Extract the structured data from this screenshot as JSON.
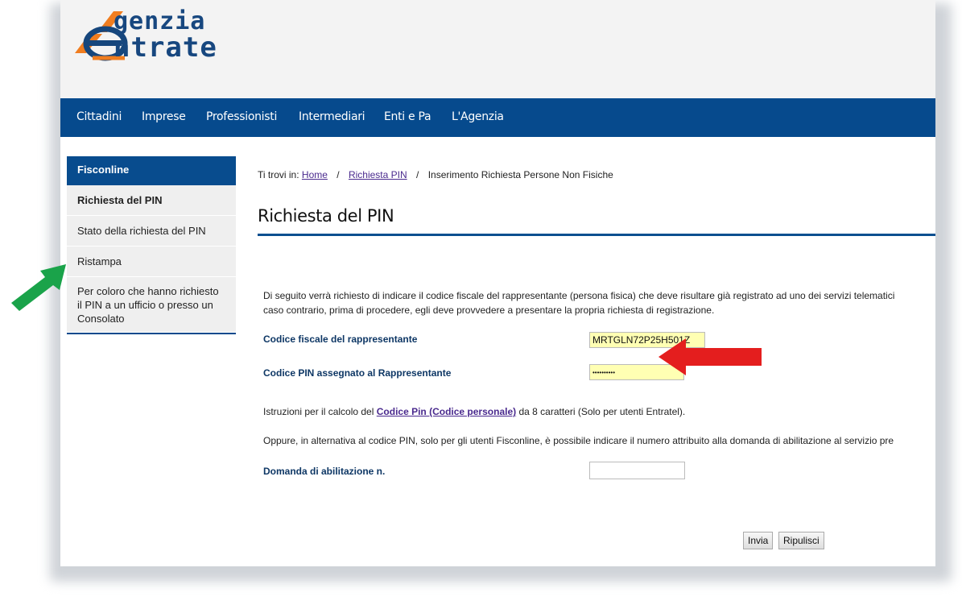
{
  "logo": {
    "line1": "genzia",
    "line2": "ntrate"
  },
  "nav": {
    "items": [
      "Cittadini",
      "Imprese",
      "Professionisti",
      "Intermediari",
      "Enti e Pa",
      "L'Agenzia"
    ]
  },
  "sidebar": {
    "heading": "Fisconline",
    "items": [
      "Richiesta del PIN",
      "Stato della richiesta del PIN",
      "Ristampa",
      "Per coloro che hanno richiesto il PIN a un ufficio o presso un Consolato"
    ]
  },
  "breadcrumb": {
    "prefix": "Ti trovi in:",
    "home": "Home",
    "sep": "/",
    "link": "Richiesta PIN",
    "current": "Inserimento Richiesta Persone Non Fisiche"
  },
  "page": {
    "title": "Richiesta del PIN",
    "intro_line1": "Di seguito verrà richiesto di indicare il codice fiscale del rappresentante (persona fisica) che deve risultare già registrato ad uno dei servizi telematici",
    "intro_line2": "caso contrario, prima di procedere, egli deve provvedere a presentare la propria richiesta di registrazione.",
    "instructions_prefix": "Istruzioni per il calcolo del",
    "instructions_link": "Codice Pin (Codice personale)",
    "instructions_suffix": "da 8 caratteri (Solo per utenti Entratel).",
    "alternative": "Oppure, in alternativa al codice PIN, solo per gli utenti Fisconline, è possibile indicare il numero attribuito alla domanda di abilitazione al servizio pre"
  },
  "form": {
    "cf_label": "Codice fiscale del rappresentante",
    "cf_value": "MRTGLN72P25H501Z",
    "pin_label": "Codice PIN assegnato al Rappresentante",
    "pin_value": "••••••••••",
    "domanda_label": "Domanda di abilitazione n.",
    "domanda_value": "",
    "submit_label": "Invia",
    "reset_label": "Ripulisci"
  },
  "colors": {
    "nav": "#064a8d",
    "accent_green": "#1aa34a",
    "accent_red": "#e41e1e",
    "highlight": "#ffffb3"
  },
  "annotations": {
    "green_arrow": "arrow-icon",
    "red_arrow": "arrow-icon"
  }
}
